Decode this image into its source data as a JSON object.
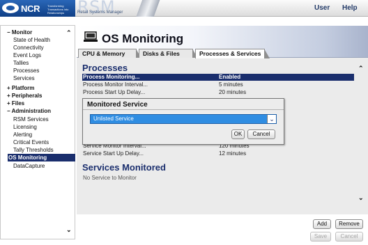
{
  "header": {
    "brand": "NCR",
    "brand_tagline": "Transforming Transactions into Relationships",
    "product_short": "RSM",
    "product_name": "Retail Systems Manager",
    "user_label": "User",
    "help_label": "Help"
  },
  "sidebar": {
    "monitor": "− Monitor",
    "state_of_health": "State of Health",
    "connectivity": "Connectivity",
    "event_logs": "Event Logs",
    "tallies": "Tallies",
    "processes": "Processes",
    "services": "Services",
    "platform": "+ Platform",
    "peripherals": "+ Peripherals",
    "files": "+ Files",
    "administration": "− Administration",
    "rsm_services": "RSM Services",
    "licensing": "Licensing",
    "alerting": "Alerting",
    "critical_events": "Critical Events",
    "tally_thresholds": "Tally Thresholds",
    "os_monitoring": "OS Monitoring",
    "datacapture": "DataCapture"
  },
  "page": {
    "title": "OS Monitoring",
    "tabs": [
      "CPU & Memory",
      "Disks & Files",
      "Processes & Services"
    ],
    "selected_tab": "Processes & Services"
  },
  "processes": {
    "heading": "Processes",
    "rows": [
      {
        "name": "Process Monitoring...",
        "value": "Enabled"
      },
      {
        "name": "Process Monitor Interval...",
        "value": "5 minutes"
      },
      {
        "name": "Process Start Up Delay...",
        "value": "20 minutes"
      },
      {
        "name": "Service Monitor Interval...",
        "value": "120 minutes"
      },
      {
        "name": "Service Start Up Delay...",
        "value": "12 minutes"
      }
    ]
  },
  "services": {
    "heading": "Services Monitored",
    "empty_text": "No Service to Monitor"
  },
  "buttons": {
    "add": "Add",
    "remove": "Remove",
    "save": "Save",
    "cancel": "Cancel"
  },
  "modal": {
    "title": "Monitored Service",
    "selected_option": "Unlisted Service",
    "ok": "OK",
    "cancel": "Cancel"
  },
  "colors": {
    "accent_navy": "#1a2e6d",
    "select_blue": "#2f8de2"
  }
}
